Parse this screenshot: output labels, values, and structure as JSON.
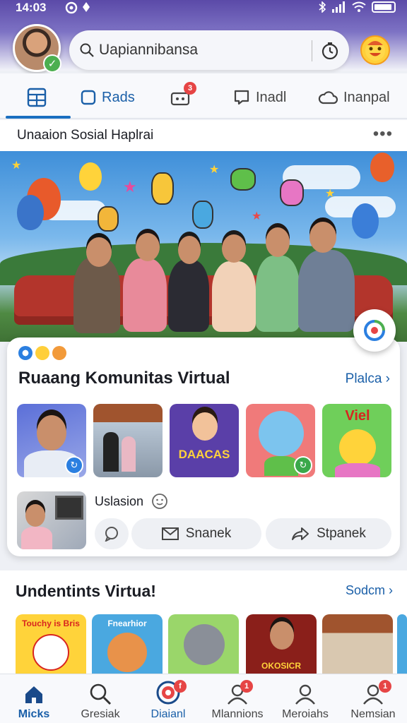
{
  "status_bar": {
    "time": "14:03"
  },
  "header": {
    "search": {
      "placeholder": "Uapiannibansa"
    }
  },
  "tabs": [
    {
      "label": "",
      "icon": "grid-icon",
      "active": true
    },
    {
      "label": "Rads",
      "icon": "square-icon"
    },
    {
      "label": "",
      "icon": "game-icon",
      "badge": "3"
    },
    {
      "label": "Inadl",
      "icon": "chat-icon"
    },
    {
      "label": "Inanpal",
      "icon": "cloud-icon"
    }
  ],
  "section_header": {
    "title": "Unaaion Sosial Haplrai"
  },
  "community_card": {
    "title": "Ruaang Komunitas Virtual",
    "link": "Plalca",
    "user_name": "Uslasion",
    "thumb_texts": [
      "DAACAS",
      "Viel"
    ],
    "actions": {
      "share": "Snanek",
      "forward": "Stpanek"
    }
  },
  "section2": {
    "title": "Undentints Virtua!",
    "link": "Sodcm",
    "thumb_texts": [
      "Touchy is Bris",
      "Fnearhior",
      "OKOSICR"
    ]
  },
  "bottom_nav": [
    {
      "label": "Micks",
      "icon": "home-icon",
      "active": true
    },
    {
      "label": "Gresiak",
      "icon": "search-icon"
    },
    {
      "label": "Diaianl",
      "icon": "target-icon",
      "badge": "f",
      "current": true
    },
    {
      "label": "Mlannions",
      "icon": "person-icon",
      "badge": "1"
    },
    {
      "label": "Meroiahs",
      "icon": "person-icon"
    },
    {
      "label": "Nemsian",
      "icon": "person-icon",
      "badge": "1"
    }
  ],
  "colors": {
    "accent": "#1a5fa8",
    "header": "#5b4aa8",
    "badge": "#e64545"
  }
}
